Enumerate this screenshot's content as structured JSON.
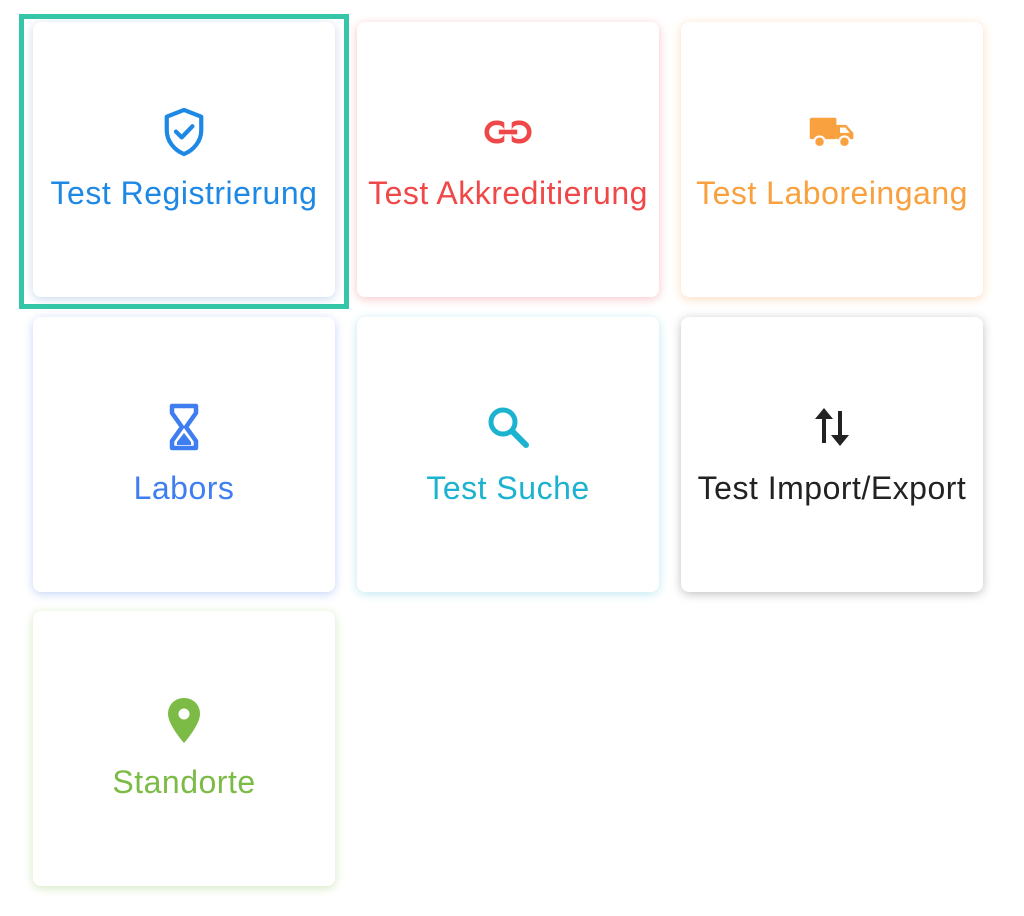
{
  "tiles": [
    {
      "label": "Test Registrierung",
      "icon": "shield-check-icon",
      "color": "#1e88e5",
      "shadow": "#c9d9ee",
      "selected": true
    },
    {
      "label": "Test Akkreditierung",
      "icon": "link-icon",
      "color": "#f04848",
      "shadow": "#f7c5c8",
      "selected": false
    },
    {
      "label": "Test Laboreingang",
      "icon": "truck-icon",
      "color": "#f9a03f",
      "shadow": "#fbdcbc",
      "selected": false
    },
    {
      "label": "Labors",
      "icon": "hourglass-icon",
      "color": "#3f7ef0",
      "shadow": "#c4d4f7",
      "selected": false
    },
    {
      "label": "Test Suche",
      "icon": "search-icon",
      "color": "#1bb3cf",
      "shadow": "#c0e8f0",
      "selected": false
    },
    {
      "label": "Test Import/Export",
      "icon": "import-export-icon",
      "color": "#222222",
      "shadow": "#bfbfbf",
      "selected": false
    },
    {
      "label": "Standorte",
      "icon": "location-pin-icon",
      "color": "#7dbb47",
      "shadow": "#d3e8bf",
      "selected": false
    }
  ]
}
